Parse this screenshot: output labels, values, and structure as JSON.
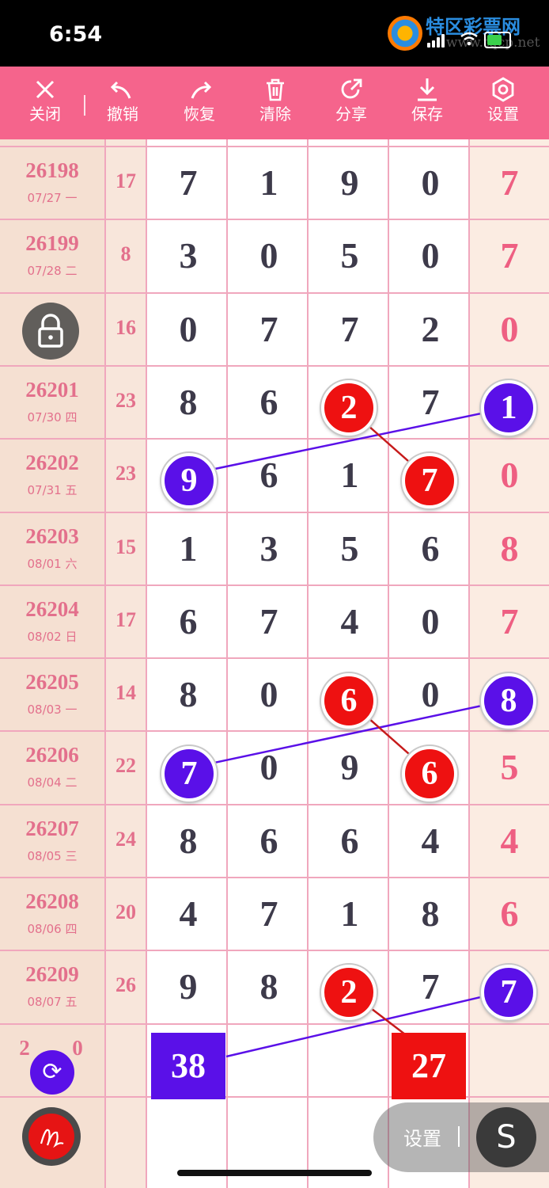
{
  "status_bar": {
    "time": "6:54",
    "watermark_text": "特区彩票网",
    "watermark_url": "www.tqcp.net"
  },
  "toolbar": {
    "items": [
      {
        "label": "关闭",
        "icon": "close-icon"
      },
      {
        "label": "撤销",
        "icon": "undo-icon"
      },
      {
        "label": "恢复",
        "icon": "redo-icon"
      },
      {
        "label": "清除",
        "icon": "trash-icon"
      },
      {
        "label": "分享",
        "icon": "share-icon"
      },
      {
        "label": "保存",
        "icon": "download-icon"
      },
      {
        "label": "设置",
        "icon": "settings-icon"
      }
    ]
  },
  "rows": [
    {
      "issue": "26198",
      "date": "07/27 一",
      "sum": "17",
      "d": [
        "7",
        "1",
        "9",
        "0"
      ],
      "last": "7"
    },
    {
      "issue": "26199",
      "date": "07/28 二",
      "sum": "8",
      "d": [
        "3",
        "0",
        "5",
        "0"
      ],
      "last": "7"
    },
    {
      "issue": "",
      "date": "",
      "sum": "16",
      "d": [
        "0",
        "7",
        "7",
        "2"
      ],
      "last": "0"
    },
    {
      "issue": "26201",
      "date": "07/30 四",
      "sum": "23",
      "d": [
        "8",
        "6",
        "2",
        "7"
      ],
      "last": "1"
    },
    {
      "issue": "26202",
      "date": "07/31 五",
      "sum": "23",
      "d": [
        "9",
        "6",
        "1",
        "7"
      ],
      "last": "0"
    },
    {
      "issue": "26203",
      "date": "08/01 六",
      "sum": "15",
      "d": [
        "1",
        "3",
        "5",
        "6"
      ],
      "last": "8"
    },
    {
      "issue": "26204",
      "date": "08/02 日",
      "sum": "17",
      "d": [
        "6",
        "7",
        "4",
        "0"
      ],
      "last": "7"
    },
    {
      "issue": "26205",
      "date": "08/03 一",
      "sum": "14",
      "d": [
        "8",
        "0",
        "6",
        "0"
      ],
      "last": "8"
    },
    {
      "issue": "26206",
      "date": "08/04 二",
      "sum": "22",
      "d": [
        "7",
        "0",
        "9",
        "6"
      ],
      "last": "5"
    },
    {
      "issue": "26207",
      "date": "08/05 三",
      "sum": "24",
      "d": [
        "8",
        "6",
        "6",
        "4"
      ],
      "last": "4"
    },
    {
      "issue": "26208",
      "date": "08/06 四",
      "sum": "20",
      "d": [
        "4",
        "7",
        "1",
        "8"
      ],
      "last": "6"
    },
    {
      "issue": "26209",
      "date": "08/07 五",
      "sum": "26",
      "d": [
        "9",
        "8",
        "2",
        "7"
      ],
      "last": "7"
    }
  ],
  "partial_issue": "2",
  "partial_issue_tail": "0",
  "highlights": {
    "purple_sum_box": "38",
    "red_sum_box": "27"
  },
  "colors": {
    "toolbar": "#f5648c",
    "red_ball": "#ee1111",
    "purple_ball": "#5a10e8",
    "accent_text": "#e3708c"
  },
  "floating": {
    "settings_label": "设置",
    "s_button": "S"
  }
}
